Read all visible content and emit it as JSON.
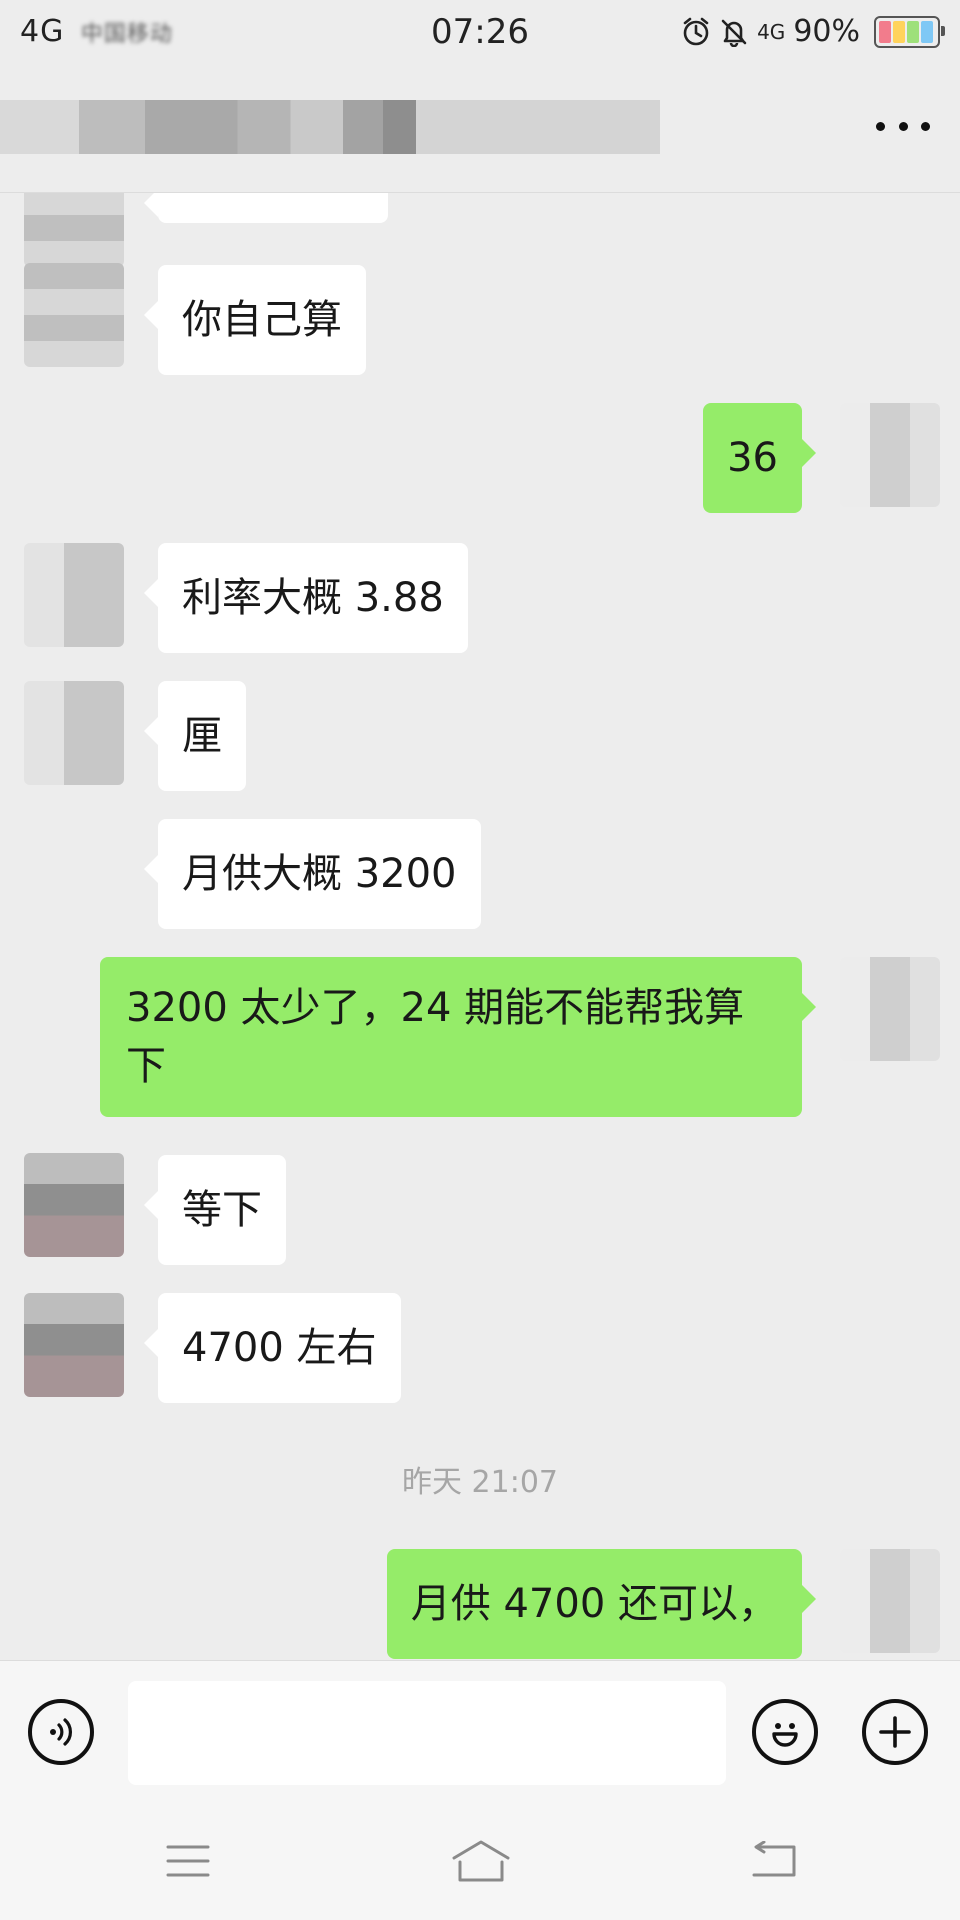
{
  "status_bar": {
    "network": "4G",
    "carrier": "中国移动",
    "time": "07:26",
    "network_right": "4G",
    "battery": "90%",
    "icons": [
      "alarm-icon",
      "bell-off-icon"
    ]
  },
  "header": {
    "more_icon": "more-icon"
  },
  "messages": [
    {
      "side": "in",
      "text": "你自己算"
    },
    {
      "side": "out",
      "text": "36"
    },
    {
      "side": "in",
      "text": "利率大概 3.88"
    },
    {
      "side": "in",
      "text": "厘"
    },
    {
      "side": "in",
      "text": "月供大概 3200"
    },
    {
      "side": "out",
      "text": "3200 太少了，24 期能不能帮我算下"
    },
    {
      "side": "in",
      "text": "等下"
    },
    {
      "side": "in",
      "text": "4700 左右"
    },
    {
      "side": "out",
      "text": "月供 4700 还可以，"
    }
  ],
  "timestamp": "昨天 21:07",
  "input_bar": {
    "voice_icon": "voice-icon",
    "emoji_icon": "emoji-icon",
    "plus_icon": "plus-icon",
    "input_value": ""
  },
  "nav_bar": {
    "menu_icon": "menu-icon",
    "home_icon": "home-icon",
    "back_icon": "back-icon"
  },
  "colors": {
    "bubble_out": "#95ec69",
    "bubble_in": "#ffffff",
    "background": "#ededed"
  }
}
